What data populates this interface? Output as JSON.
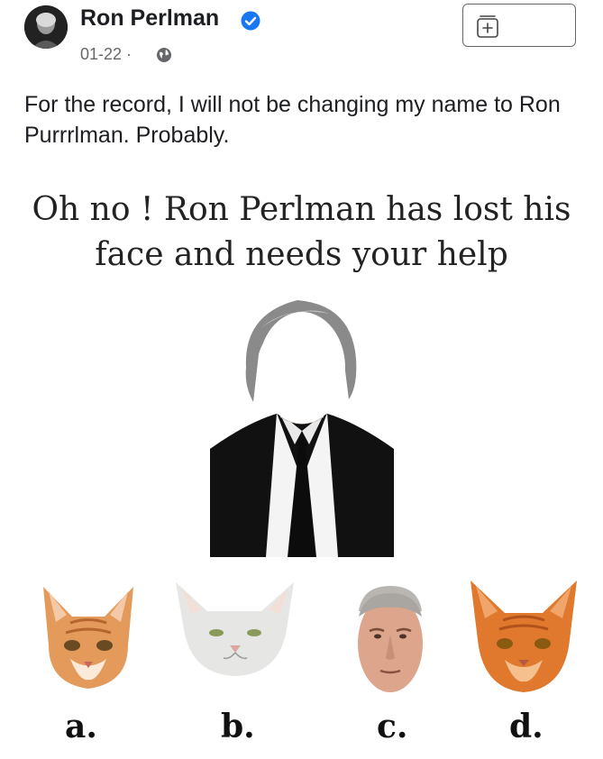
{
  "post": {
    "author": "Ron Perlman",
    "verified": true,
    "date": "01-22",
    "separator": " · ",
    "audience_icon": "globe-icon",
    "avatar_icon": "profile-avatar",
    "save_icon": "save-collection-icon",
    "text": "For the record, I will not be changing my name to Ron Purrrlman. Probably."
  },
  "meme": {
    "title": "Oh no ! Ron Perlman has lost his face and needs your help",
    "options": [
      {
        "label": "a.",
        "face": "orange-tabby-cat"
      },
      {
        "label": "b.",
        "face": "white-cat"
      },
      {
        "label": "c.",
        "face": "ron-perlman-face"
      },
      {
        "label": "d.",
        "face": "orange-cat"
      }
    ]
  },
  "colors": {
    "text": "#1c1e21",
    "secondary": "#65676b",
    "verified": "#1877f2",
    "suit": "#111111"
  }
}
